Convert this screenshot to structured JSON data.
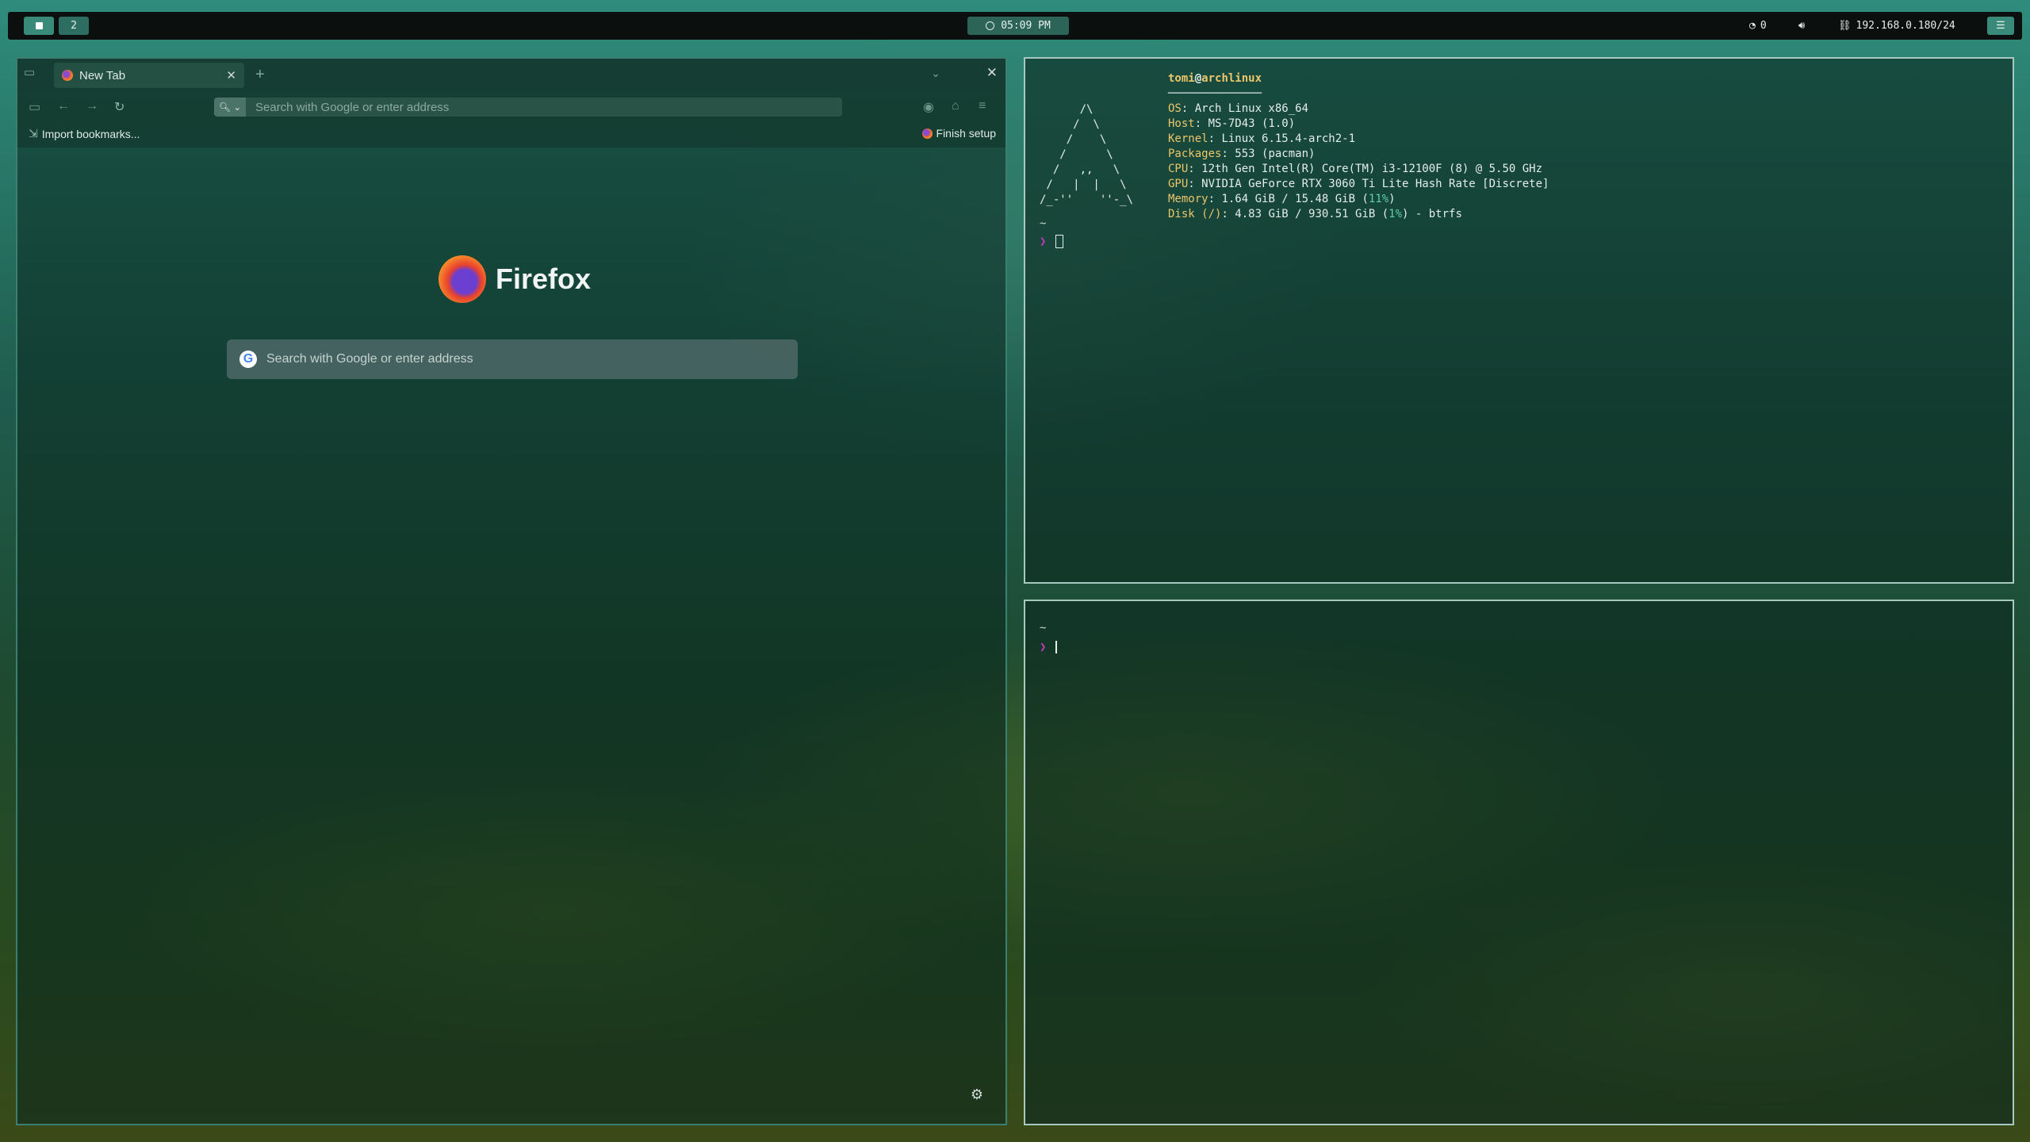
{
  "topbar": {
    "workspaces": [
      "■",
      "2"
    ],
    "clock": "05:09 PM",
    "tray_count": "0",
    "network": "192.168.0.180/24",
    "menu_icon": "menu-icon"
  },
  "firefox": {
    "tab_title": "New Tab",
    "url_placeholder": "Search with Google or enter address",
    "import_bookmarks": "Import bookmarks...",
    "finish_setup": "Finish setup",
    "brand": "Firefox",
    "search_placeholder": "Search with Google or enter address",
    "search_engine_letter": "G"
  },
  "terminal1": {
    "ascii_logo": "      /\\\n     /  \\\n    /    \\\n   /      \\\n  /   ,,   \\\n /   |  |   \\\n/_-''    ''-_\\",
    "user": "tomi",
    "at": "@",
    "host": "archlinux",
    "separator": "──────────────",
    "info": [
      {
        "key": "OS",
        "value": "Arch Linux x86_64"
      },
      {
        "key": "Host",
        "value": "MS-7D43 (1.0)"
      },
      {
        "key": "Kernel",
        "value": "Linux 6.15.4-arch2-1"
      },
      {
        "key": "Packages",
        "value": "553 (pacman)"
      },
      {
        "key": "CPU",
        "value": "12th Gen Intel(R) Core(TM) i3-12100F (8) @ 5.50 GHz"
      },
      {
        "key": "GPU",
        "value": "NVIDIA GeForce RTX 3060 Ti Lite Hash Rate [Discrete]"
      }
    ],
    "memory": {
      "key": "Memory",
      "value": "1.64 GiB / 15.48 GiB",
      "pct": "11%"
    },
    "disk": {
      "key": "Disk (/)",
      "value": "4.83 GiB / 930.51 GiB",
      "pct": "1%",
      "fs": "btrfs"
    },
    "cwd": "~",
    "prompt_symbol": "❯"
  },
  "terminal2": {
    "cwd": "~",
    "prompt_symbol": "❯"
  }
}
